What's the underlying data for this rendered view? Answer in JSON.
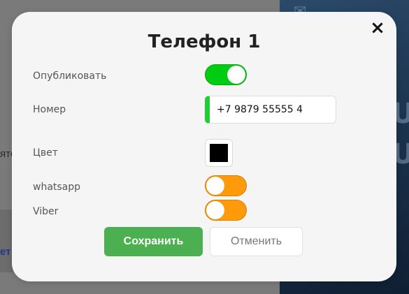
{
  "background": {
    "left_text_1": "ято",
    "left_text_2": "ет"
  },
  "modal": {
    "title": "Телефон 1",
    "close_icon": "close-icon",
    "publish": {
      "label": "Опубликовать",
      "checked": true
    },
    "phone": {
      "label": "Номер",
      "value": "+7 9879 55555 4"
    },
    "color": {
      "label": "Цвет",
      "value": "#000000"
    },
    "whatsapp": {
      "label": "whatsapp",
      "checked": false
    },
    "viber": {
      "label": "Viber",
      "checked": false
    },
    "save_label": "Сохранить",
    "cancel_label": "Отменить"
  },
  "colors": {
    "toggle_on": "#00cc11",
    "toggle_off": "#ff9a0a",
    "save_button": "#4caf50",
    "accent_green": "#22cc33"
  }
}
